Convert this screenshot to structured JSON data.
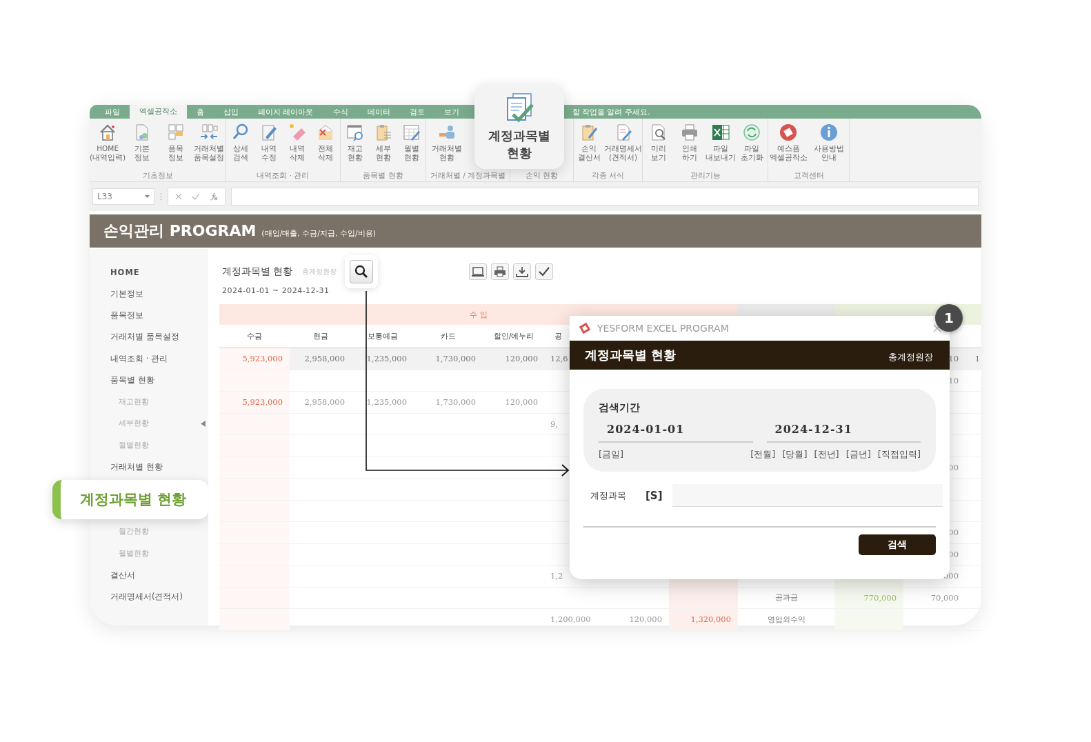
{
  "ribbon": {
    "tabs": [
      {
        "label": "파일",
        "selected": false
      },
      {
        "label": "엑셀공작소",
        "selected": true
      },
      {
        "label": "홈",
        "selected": false
      },
      {
        "label": "삽입",
        "selected": false
      },
      {
        "label": "페이지 레이아웃",
        "selected": false
      },
      {
        "label": "수식",
        "selected": false
      },
      {
        "label": "데이터",
        "selected": false
      },
      {
        "label": "검토",
        "selected": false
      },
      {
        "label": "보기",
        "selected": false
      }
    ],
    "tell_me": "할 작업을 알려 주세요.",
    "groups": [
      {
        "label": "기초정보",
        "buttons": [
          {
            "lines": [
              "HOME",
              "(내역입력)"
            ]
          },
          {
            "lines": [
              "기본",
              "정보"
            ]
          },
          {
            "lines": [
              "품목",
              "정보"
            ]
          },
          {
            "lines": [
              "거래처별",
              "품목설정"
            ]
          }
        ]
      },
      {
        "label": "내역조회 · 관리",
        "buttons": [
          {
            "lines": [
              "상세",
              "검색"
            ]
          },
          {
            "lines": [
              "내역",
              "수정"
            ]
          },
          {
            "lines": [
              "내역",
              "삭제"
            ]
          },
          {
            "lines": [
              "전체",
              "삭제"
            ]
          }
        ]
      },
      {
        "label": "품목별 현황",
        "buttons": [
          {
            "lines": [
              "재고",
              "현황"
            ]
          },
          {
            "lines": [
              "세부",
              "현황"
            ]
          },
          {
            "lines": [
              "월별",
              "현황"
            ]
          }
        ]
      },
      {
        "label": "거래처별 / 계정과목별",
        "buttons": [
          {
            "lines": [
              "거래처별",
              "현황"
            ]
          }
        ]
      },
      {
        "label": "손익 현황"
      },
      {
        "label": "각종 서식",
        "buttons": [
          {
            "lines": [
              "손익",
              "결산서"
            ]
          },
          {
            "lines": [
              "거래명세서",
              "(견적서)"
            ]
          }
        ]
      },
      {
        "label": "관리기능",
        "buttons": [
          {
            "lines": [
              "미리",
              "보기"
            ]
          },
          {
            "lines": [
              "인쇄",
              "하기"
            ]
          },
          {
            "lines": [
              "파일",
              "내보내기"
            ]
          },
          {
            "lines": [
              "파일",
              "초기화"
            ]
          }
        ]
      },
      {
        "label": "고객센터",
        "buttons": [
          {
            "lines": [
              "예스폼",
              "엑셀공작소"
            ]
          },
          {
            "lines": [
              "사용방법",
              "안내"
            ]
          }
        ]
      }
    ]
  },
  "ribbon_callout": {
    "label": "계정과목별 현황"
  },
  "formula_bar": {
    "name_box": "L33"
  },
  "app_header": {
    "title": "손익관리 PROGRAM",
    "subtitle": "(매입/매출, 수금/지급, 수입/비용)"
  },
  "sidebar": {
    "items": [
      {
        "label": "HOME",
        "kind": "main",
        "selected": false
      },
      {
        "label": "기본정보",
        "kind": "main",
        "selected": false
      },
      {
        "label": "품목정보",
        "kind": "main",
        "selected": false
      },
      {
        "label": "거래처별 품목설정",
        "kind": "main",
        "selected": false
      },
      {
        "label": "내역조회 · 관리",
        "kind": "main",
        "selected": false
      },
      {
        "label": "품목별 현황",
        "kind": "main",
        "selected": false
      },
      {
        "label": "재고현황",
        "kind": "sub",
        "selected": false
      },
      {
        "label": "세부현황",
        "kind": "sub",
        "selected": true
      },
      {
        "label": "월별현황",
        "kind": "sub",
        "selected": false
      },
      {
        "label": "거래처별 현황",
        "kind": "main",
        "selected": false
      },
      {
        "label": "계정과목별 현황",
        "kind": "callout"
      },
      {
        "label": "월간현황",
        "kind": "sub",
        "selected": false
      },
      {
        "label": "월별현황",
        "kind": "sub",
        "selected": false
      },
      {
        "label": "결산서",
        "kind": "main",
        "selected": false
      },
      {
        "label": "거래명세서(견적서)",
        "kind": "main",
        "selected": false
      }
    ]
  },
  "report": {
    "title": "계정과목별 현황",
    "subtitle": "총계정원장",
    "period": "2024-01-01 ~ 2024-12-31",
    "band": {
      "income": "수  입"
    },
    "columns": [
      {
        "label": "수금"
      },
      {
        "label": "현금"
      },
      {
        "label": "보통예금"
      },
      {
        "label": "카드"
      },
      {
        "label": "할인/에누리"
      },
      {
        "label": "공"
      }
    ],
    "rows": [
      {
        "column_1": "5,923,000",
        "column_2": "2,958,000",
        "column_3": "1,235,000",
        "column_4": "1,730,000",
        "column_5": "120,000",
        "column_6": "12,6",
        "column_11": "10",
        "column_12": "1"
      },
      {
        "column_11": "10"
      },
      {
        "column_1": "5,923,000",
        "column_2": "2,958,000",
        "column_3": "1,235,000",
        "column_4": "1,730,000",
        "column_5": "120,000"
      },
      {
        "column_6": "9,"
      },
      {},
      {
        "column_11": "00"
      },
      {},
      {},
      {
        "column_11": "00"
      },
      {
        "column_11": "00"
      },
      {
        "column_6": "1,2",
        "column_11": "000"
      },
      {
        "column_9": "공과금",
        "column_10": "770,000",
        "column_11": "70,000"
      },
      {
        "column_6": "1,200,000",
        "column_7": "120,000",
        "column_8": "1,320,000",
        "column_9": "영업외수익"
      }
    ]
  },
  "dialog": {
    "app_name": "YESFORM EXCEL PROGRAM",
    "title": "계정과목별 현황",
    "subtitle": "총계정원장",
    "period_label": "검색기간",
    "start_date": "2024-01-01",
    "end_date": "2024-12-31",
    "quick_links": [
      {
        "label": "[금일]"
      },
      {
        "label": "[전월]"
      },
      {
        "label": "[당월]"
      },
      {
        "label": "[전년]"
      },
      {
        "label": "[금년]"
      },
      {
        "label": "[직접입력]"
      }
    ],
    "account_label": "계정과목",
    "account_shortcut": "[S]",
    "search_button": "검색"
  },
  "step_badge": "1"
}
